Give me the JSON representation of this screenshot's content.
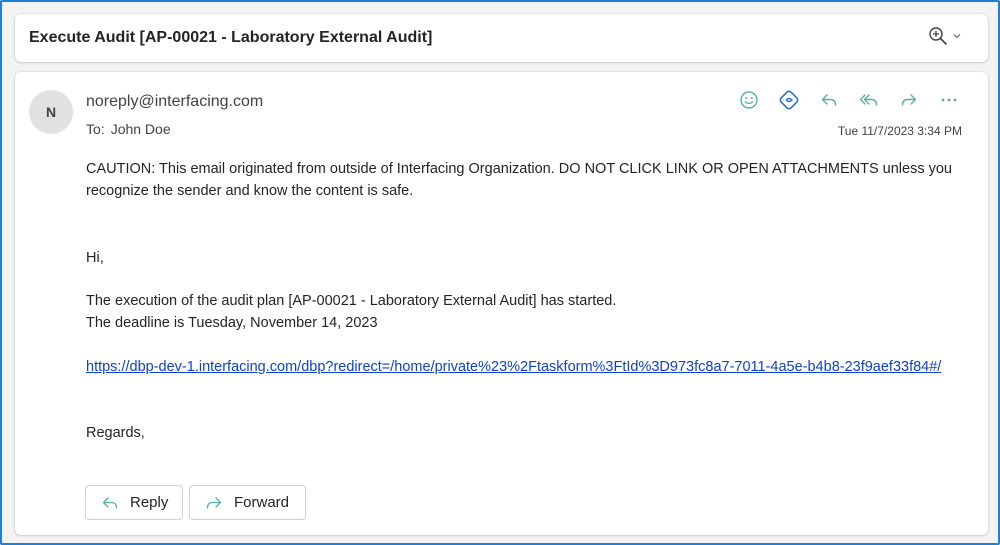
{
  "subject": {
    "title": "Execute Audit [AP-00021 - Laboratory External Audit]",
    "zoom_icon": "zoom-in-icon"
  },
  "message": {
    "avatar_initial": "N",
    "sender": "noreply@interfacing.com",
    "to_label": "To:",
    "to_name": "John Doe",
    "timestamp": "Tue 11/7/2023 3:34 PM",
    "actions": [
      "emoji-icon",
      "loop-icon",
      "reply-icon",
      "reply-all-icon",
      "forward-icon",
      "more-icon"
    ],
    "body": {
      "caution": "CAUTION: This email originated from outside of Interfacing Organization. DO NOT CLICK LINK OR OPEN ATTACHMENTS unless you recognize the sender and know the content is safe.",
      "greeting": "Hi,",
      "execution": "The execution of the audit plan [AP-00021 - Laboratory External Audit] has started.",
      "deadline": "The deadline is Tuesday, November 14, 2023",
      "link": "https://dbp-dev-1.interfacing.com/dbp?redirect=/home/private%23%2Ftaskform%3FtId%3D973fc8a7-7011-4a5e-b4b8-23f9aef33f84#/",
      "regards": "Regards,"
    }
  },
  "reply_bar": {
    "reply_label": "Reply",
    "forward_label": "Forward"
  },
  "colors": {
    "accent": "#1e7fd6",
    "action_icon": "#5aaf9f",
    "link": "#0f3fd4"
  }
}
